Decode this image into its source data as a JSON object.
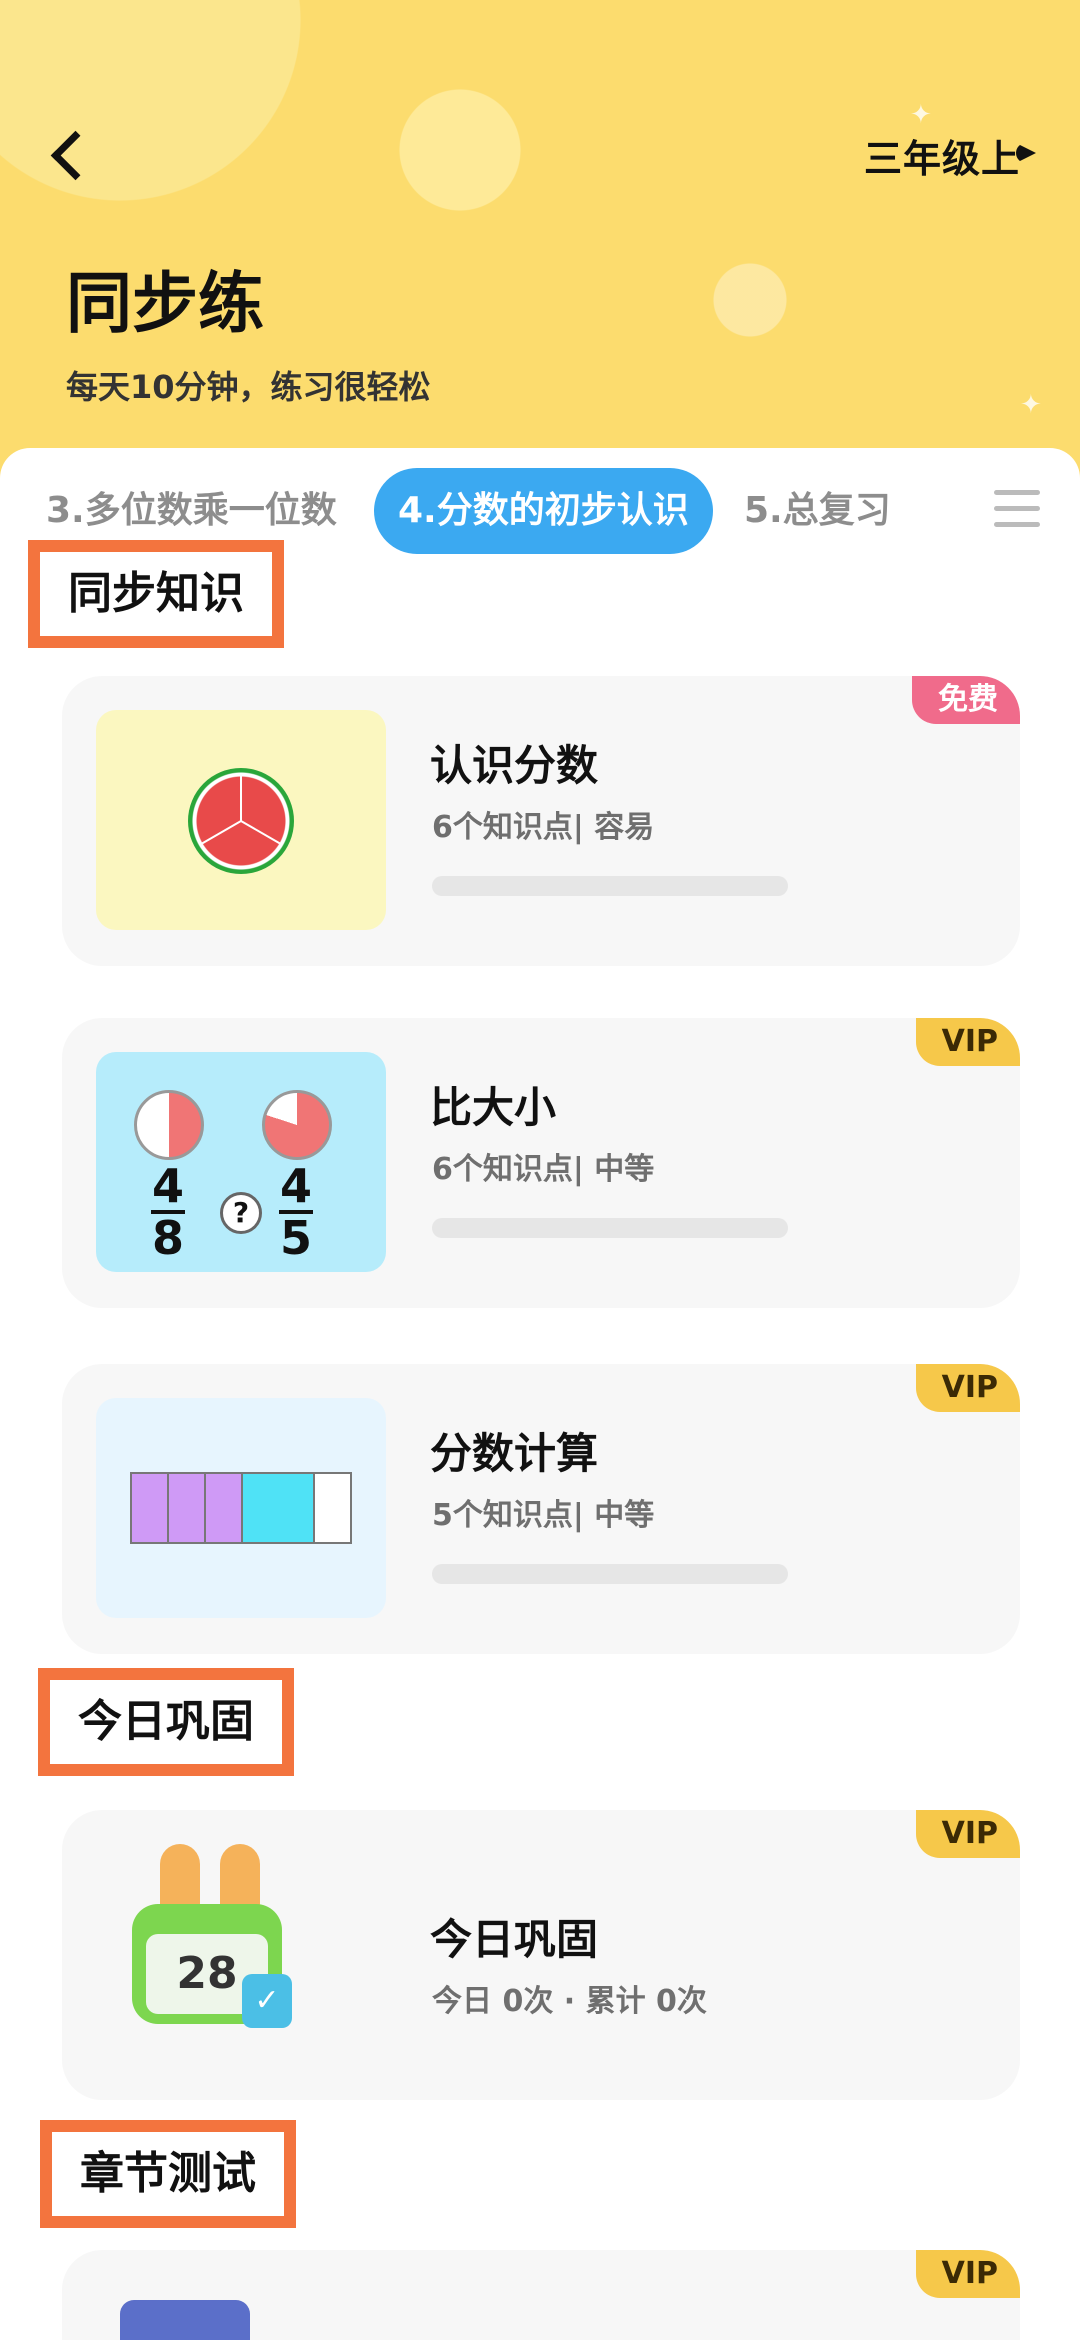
{
  "header": {
    "grade": "三年级上",
    "title": "同步练",
    "subtitle": "每天10分钟，练习很轻松"
  },
  "tabs": [
    {
      "label": "3.多位数乘一位数"
    },
    {
      "label": "4.分数的初步认识"
    },
    {
      "label": "5.总复习"
    }
  ],
  "sections": {
    "sync": "同步知识",
    "daily": "今日巩固",
    "chapter": "章节测试"
  },
  "cards": [
    {
      "title": "认识分数",
      "meta": "6个知识点| 容易",
      "badge": "免费"
    },
    {
      "title": "比大小",
      "meta": "6个知识点| 中等",
      "badge": "VIP"
    },
    {
      "title": "分数计算",
      "meta": "5个知识点| 中等",
      "badge": "VIP"
    }
  ],
  "daily_card": {
    "title": "今日巩固",
    "stats": "今日 0次 · 累计 0次",
    "badge": "VIP",
    "calendar_day": "28"
  },
  "chapter_card": {
    "badge": "VIP"
  },
  "fractions": {
    "left_num": "4",
    "left_den": "8",
    "right_num": "4",
    "right_den": "5",
    "question": "?"
  },
  "colors": {
    "accent": "#3ba9f1",
    "header": "#fcdc6e",
    "section_border": "#f3743e",
    "vip": "#f6c84a",
    "free": "#f06b8b"
  }
}
